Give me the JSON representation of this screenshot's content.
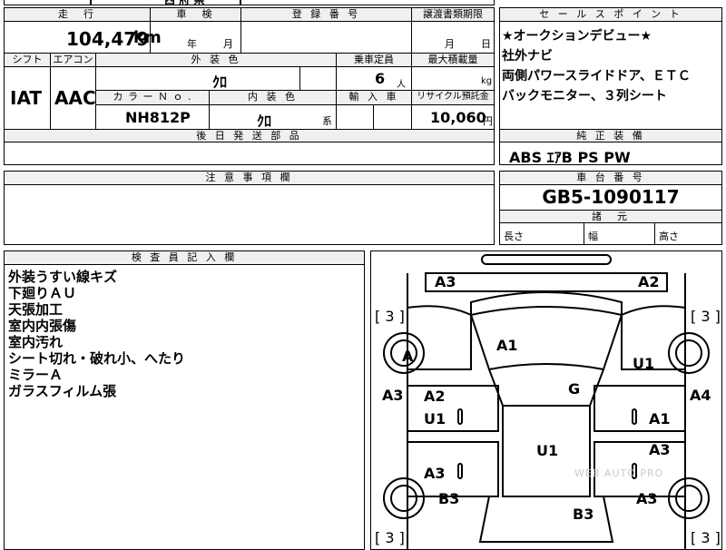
{
  "top": {
    "fragment": "西 府 県"
  },
  "mileage": {
    "header": "走　行",
    "value": "104,479",
    "unit": "km"
  },
  "inspection": {
    "header": "車　検",
    "year_label": "年",
    "month_label": "月"
  },
  "registration": {
    "header": "登 録 番 号",
    "value": ""
  },
  "transfer_deadline": {
    "header": "譲渡書類期限",
    "month_label": "月",
    "day_label": "日"
  },
  "shift": {
    "header": "シフト",
    "value": "IAT"
  },
  "aircon": {
    "header": "エアコン",
    "value": "AAC"
  },
  "exterior_color": {
    "header": "外 装 色",
    "value": "ｸﾛ"
  },
  "capacity": {
    "header": "乗車定員",
    "value": "6",
    "unit": "人"
  },
  "max_load": {
    "header": "最大積載量",
    "unit": "kg"
  },
  "color_no": {
    "header": "カ ラ ー Ｎ ｏ .",
    "value": "NH812P"
  },
  "interior_color": {
    "header": "内 装 色",
    "value": "ｸﾛ",
    "suffix": "系"
  },
  "import": {
    "header": "輸 入 車"
  },
  "recycle": {
    "header": "リサイクル預託金",
    "value": "10,060",
    "unit": "円"
  },
  "later_parts": {
    "header": "後 日 発 送 部 品"
  },
  "notes": {
    "header": "注 意 事 項 欄"
  },
  "sales_point": {
    "header": "セ ー ル ス ポ イ ン ト",
    "lines": [
      "★オークションデビュー★",
      "社外ナビ",
      "両側パワースライドドア、ＥＴＣ",
      "バックモニター、３列シート"
    ]
  },
  "equipment": {
    "header": "純 正 装 備",
    "value": "ABS ｴｱB PS PW"
  },
  "chassis": {
    "header": "車 台 番 号",
    "value": "GB5-1090117"
  },
  "dimensions": {
    "header": "諸　元",
    "length": "長さ",
    "width": "幅",
    "height": "高さ"
  },
  "inspector": {
    "header": "検 査 員 記 入 欄",
    "lines": [
      "外装うすい線キズ",
      "下廻りＡＵ",
      "天張加工",
      "室内内張傷",
      "室内汚れ",
      "シート切れ・破れ小、へたり",
      "ミラーＡ",
      "ガラスフィルム張"
    ]
  },
  "diagram": {
    "tires": [
      "[ 3 ]",
      "[ 3 ]",
      "[ 3 ]",
      "[ 3 ]"
    ],
    "labels": {
      "front_left": "A3",
      "front_right": "A2",
      "tire_fl": "A",
      "tire_fr": "U1",
      "hood": "A1",
      "windshield": "G",
      "left_fender": "A3",
      "right_fender": "A4",
      "door_fl_1": "A2",
      "door_fl_2": "U1",
      "door_fr": "A1",
      "roof": "U1",
      "door_rl": "A3",
      "door_rr": "A3",
      "rear_left": "B3",
      "rear_right": "A3",
      "tailgate": "B3"
    },
    "watermark": "WEB AUTO PRO"
  }
}
